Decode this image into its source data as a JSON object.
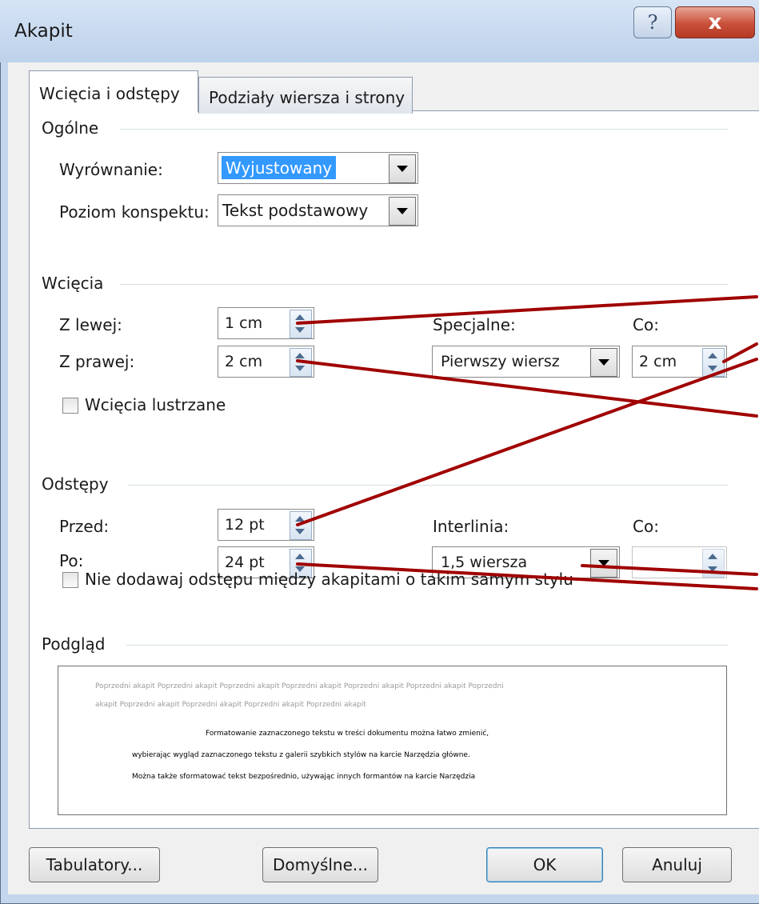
{
  "window": {
    "title": "Akapit",
    "help_label": "?",
    "close_label": "x"
  },
  "tabs": [
    {
      "label": "Wcięcia i odstępy",
      "active": true
    },
    {
      "label": "Podziały wiersza i strony",
      "active": false
    }
  ],
  "general": {
    "heading": "Ogólne",
    "alignment": {
      "label": "Wyrównanie:",
      "value": "Wyjustowany"
    },
    "outline_level": {
      "label": "Poziom konspektu:",
      "value": "Tekst podstawowy"
    }
  },
  "indents": {
    "heading": "Wcięcia",
    "left": {
      "label": "Z lewej:",
      "value": "1 cm"
    },
    "right": {
      "label": "Z prawej:",
      "value": "2 cm"
    },
    "special": {
      "label": "Specjalne:",
      "value": "Pierwszy wiersz"
    },
    "by": {
      "label": "Co:",
      "value": "2 cm"
    },
    "mirror": {
      "label": "Wcięcia lustrzane",
      "checked": false
    }
  },
  "spacing": {
    "heading": "Odstępy",
    "before": {
      "label": "Przed:",
      "value": "12 pt"
    },
    "after": {
      "label": "Po:",
      "value": "24 pt"
    },
    "line_spacing": {
      "label": "Interlinia:",
      "value": "1,5 wiersza"
    },
    "at": {
      "label": "Co:",
      "value": ""
    },
    "no_space": {
      "label": "Nie dodawaj odstępu między akapitami o takim samym stylu",
      "checked": false
    }
  },
  "preview": {
    "heading": "Podgląd",
    "prev_line1": "Poprzedni akapit Poprzedni akapit Poprzedni akapit Poprzedni akapit Poprzedni akapit Poprzedni akapit Poprzedni",
    "prev_line2": "akapit Poprzedni akapit Poprzedni akapit Poprzedni akapit Poprzedni akapit",
    "body_line1": "Formatowanie zaznaczonego tekstu w treści dokumentu można łatwo zmienić,",
    "body_line2": "wybierając wygląd zaznaczonego tekstu z galerii szybkich stylów na karcie Narzędzia główne.",
    "body_line3": "Można także sformatować tekst bezpośrednio, używając innych formantów na karcie Narzędzia"
  },
  "buttons": {
    "tabs": "Tabulatory...",
    "default": "Domyślne...",
    "ok": "OK",
    "cancel": "Anuluj"
  },
  "colors": {
    "annotation_line": "#a00000",
    "selection": "#3399ff"
  }
}
